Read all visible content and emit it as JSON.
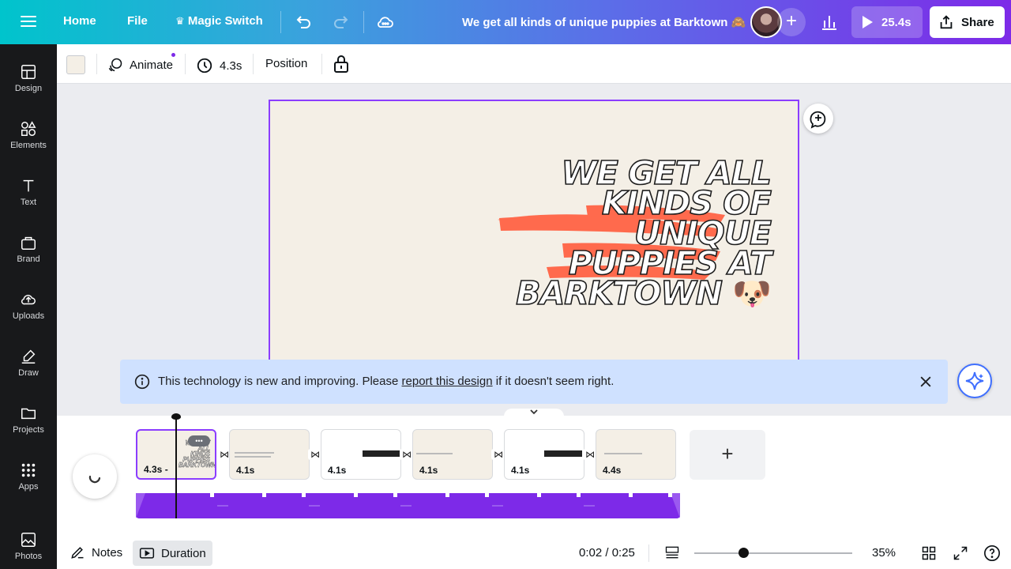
{
  "topbar": {
    "home": "Home",
    "file": "File",
    "magic_switch": "Magic Switch",
    "doc_title": "We get all kinds of unique puppies at Barktown 🙈",
    "play_label": "25.4s",
    "share_label": "Share"
  },
  "sidebar": {
    "items": [
      {
        "label": "Design",
        "icon": "design-icon"
      },
      {
        "label": "Elements",
        "icon": "elements-icon"
      },
      {
        "label": "Text",
        "icon": "text-icon"
      },
      {
        "label": "Brand",
        "icon": "brand-icon"
      },
      {
        "label": "Uploads",
        "icon": "uploads-icon"
      },
      {
        "label": "Draw",
        "icon": "draw-icon"
      },
      {
        "label": "Projects",
        "icon": "projects-icon"
      },
      {
        "label": "Apps",
        "icon": "apps-icon"
      },
      {
        "label": "Photos",
        "icon": "photos-icon"
      }
    ]
  },
  "toolbar": {
    "animate": "Animate",
    "timing": "4.3s",
    "position": "Position",
    "swatch_color": "#f4efe6"
  },
  "canvas": {
    "headline": "WE GET ALL KINDS OF UNIQUE PUPPIES AT BARKTOWN",
    "emoji": "🐶",
    "accent_color": "#ff6a4d",
    "selection_color": "#8b3dff"
  },
  "banner": {
    "text_before": "This technology is new and improving. Please",
    "link": "report this design",
    "text_after": "if it doesn't seem right."
  },
  "timeline": {
    "scenes": [
      {
        "duration": "4.3s -"
      },
      {
        "duration": "4.1s"
      },
      {
        "duration": "4.1s"
      },
      {
        "duration": "4.1s"
      },
      {
        "duration": "4.1s"
      },
      {
        "duration": "4.4s"
      }
    ],
    "more_label": "•••"
  },
  "footer": {
    "notes": "Notes",
    "duration": "Duration",
    "time": "0:02 / 0:25",
    "zoom": "35%"
  }
}
